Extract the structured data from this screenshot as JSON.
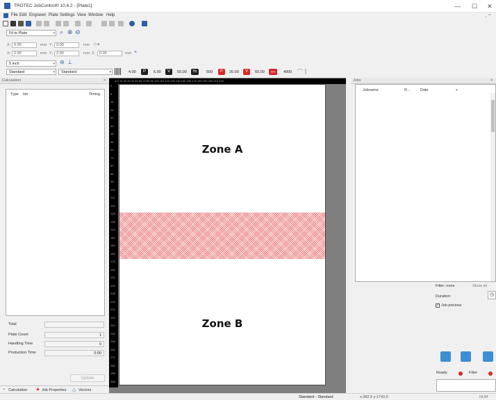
{
  "window": {
    "title": "TROTEC JobControl® 10.6.2 - [Plate1]",
    "minimize": "—",
    "maximize": "☐",
    "close": "✕"
  },
  "menu": {
    "items": [
      "File",
      "Edit",
      "Engraver",
      "Plate",
      "Settings",
      "View",
      "Window",
      "Help"
    ],
    "doc_controls": "_ ="
  },
  "toolbar": {
    "zoom_mode": "Fit to Plate",
    "x_label": "X:",
    "x_value": "0.00",
    "x_unit": "mm",
    "y_label": "Y:",
    "y_value": "0.00",
    "y_unit": "mm",
    "x2_label": "X:",
    "x2_value": "2.00",
    "x2_unit": "mm",
    "y2_label": "Y:",
    "y2_value": "2.00",
    "y2_unit": "mm",
    "z_label": "Z:",
    "z_value": "0.00",
    "z_unit": "mm",
    "size": "5 inch",
    "material_profile": "Standard",
    "process_profile": "Standard",
    "power": "4.00",
    "speed": "6.00",
    "frequency": "50.00",
    "ppi": "500",
    "power2": "20.00",
    "speed2": "60.00",
    "ppi2": "4000",
    "p_badge": "P",
    "v_badge": "V",
    "hz_badge": "Hz",
    "ppi_badge": "PPI"
  },
  "calculation": {
    "title": "Calculation",
    "col_type": "Type",
    "col_ids": "Ids",
    "col_timing": "Timing",
    "total_label": "Total",
    "plate_count_label": "Plate Count",
    "plate_count": "1",
    "handling_time_label": "Handling Time",
    "handling_time": "0",
    "production_time_label": "Production Time",
    "production_time": "0:00",
    "update_button": "Update"
  },
  "bottom_tabs": [
    "Calculation",
    "Job Properties",
    "Vectors"
  ],
  "canvas": {
    "zone_a": "Zone A",
    "zone_b": "Zone B",
    "ruler_top": "-4 0 10 20 30 40 50 60 70 80 90 100 110 120 130 140 150 160 170 180 190 200 210 216",
    "ruler_left": [
      "0",
      "8",
      "16",
      "24",
      "32",
      "40",
      "48",
      "56",
      "64",
      "72",
      "80",
      "88",
      "96",
      "104",
      "112",
      "120",
      "128",
      "136",
      "144",
      "152",
      "160",
      "168",
      "176",
      "184",
      "192",
      "200",
      "208",
      "216",
      "224",
      "232",
      "240",
      "248",
      "256",
      "264",
      "272",
      "280",
      "288",
      "296"
    ]
  },
  "jobs": {
    "title": "Jobs",
    "col_jobname": "Jobname",
    "col_r": "R...",
    "col_date": "Date",
    "filter_label": "Filter: none",
    "show_all": "Show all",
    "duration_label": "Duration:",
    "job_preview_label": "Job preview",
    "ready_label": "Ready",
    "filter_status_label": "Filter"
  },
  "statusbar": {
    "profile": "Standard - Standard",
    "coords": "x:382.5  y:1743.9",
    "num": "NUM"
  },
  "colors": {
    "accent": "#3d8fd3",
    "hatch": "#d62828",
    "canvas_bg": "#7f7f7f"
  }
}
